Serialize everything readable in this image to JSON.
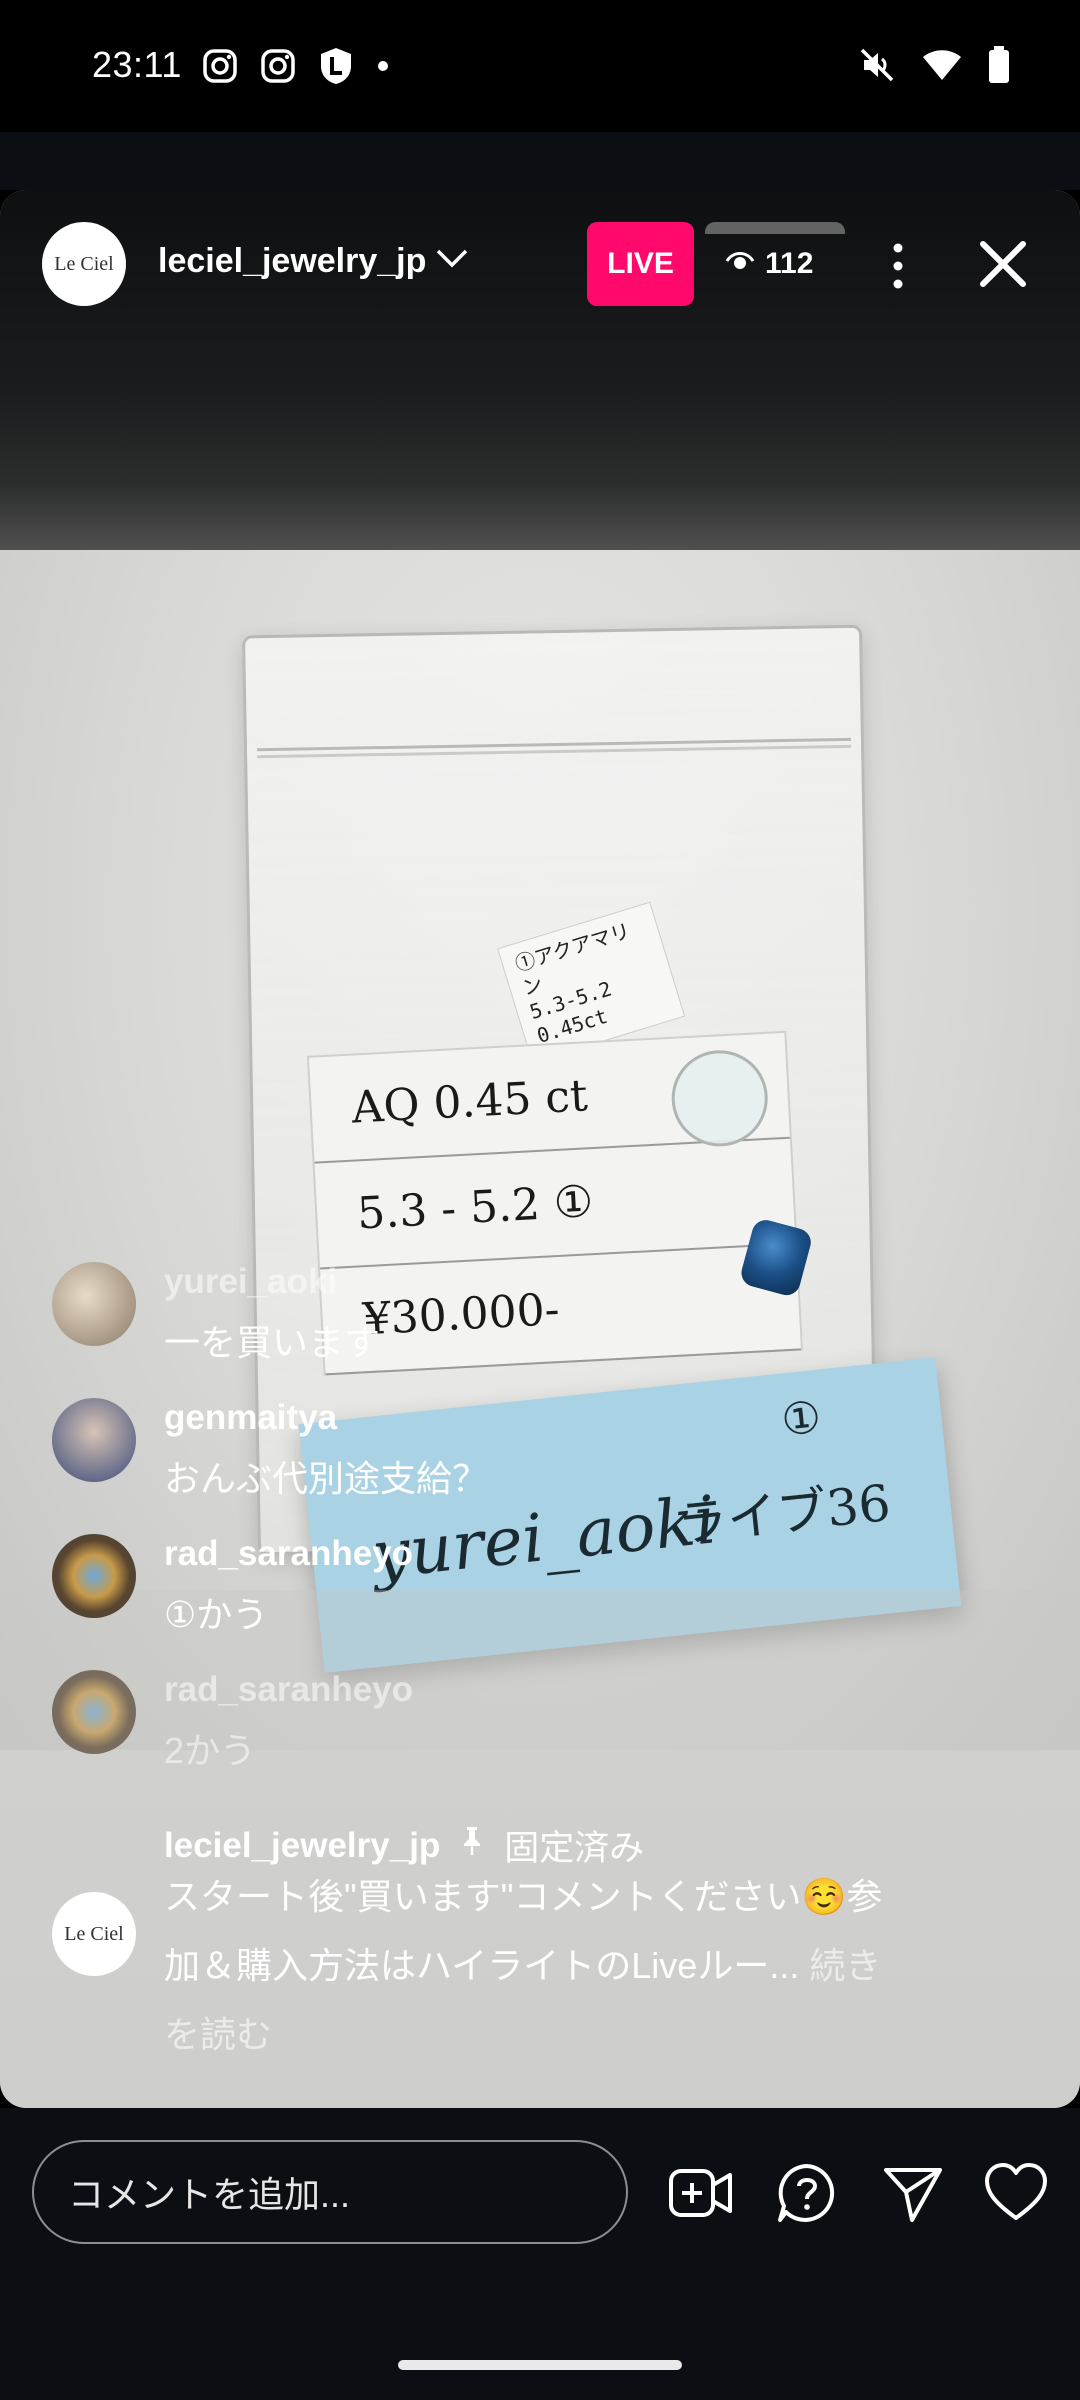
{
  "status_bar": {
    "time": "23:11",
    "left_icons": [
      "instagram-icon",
      "instagram-icon",
      "shield-l-icon",
      "dot-icon"
    ],
    "right_icons": [
      "mute-icon",
      "wifi-icon",
      "battery-icon"
    ]
  },
  "header": {
    "host_avatar_text": "Le Ciel",
    "host_name": "leciel_jewelry_jp",
    "live_label": "LIVE",
    "viewer_count": "112"
  },
  "video": {
    "label_lines": [
      "①アクアマリン",
      "5.3-5.2",
      "0.45ct"
    ],
    "card_rows": [
      "AQ 0.45 ct",
      "5.3 - 5.2  ①",
      "¥30.000-"
    ],
    "sticky_num": "①",
    "sticky_user": "yurei_aoki",
    "sticky_note": "ライブ36"
  },
  "comments": [
    {
      "user": "yurei_aoki",
      "text": "一を買います",
      "faded": true
    },
    {
      "user": "genmaitya",
      "text": "おんぶ代別途支給？",
      "faded": false
    },
    {
      "user": "rad_saranheyo",
      "text": "①かう",
      "faded": false
    },
    {
      "user": "rad_saranheyo",
      "text": "2かう",
      "faded": true
    }
  ],
  "pinned": {
    "user": "leciel_jewelry_jp",
    "pin_label": "固定済み",
    "avatar_text": "Le Ciel",
    "line1": "スタート後\"買います\"コメントください☺️参",
    "line2": "加＆購入方法はハイライトのLiveルー...",
    "more1": "続き",
    "more2": "を読む"
  },
  "bottom_bar": {
    "comment_placeholder": "コメントを追加..."
  }
}
